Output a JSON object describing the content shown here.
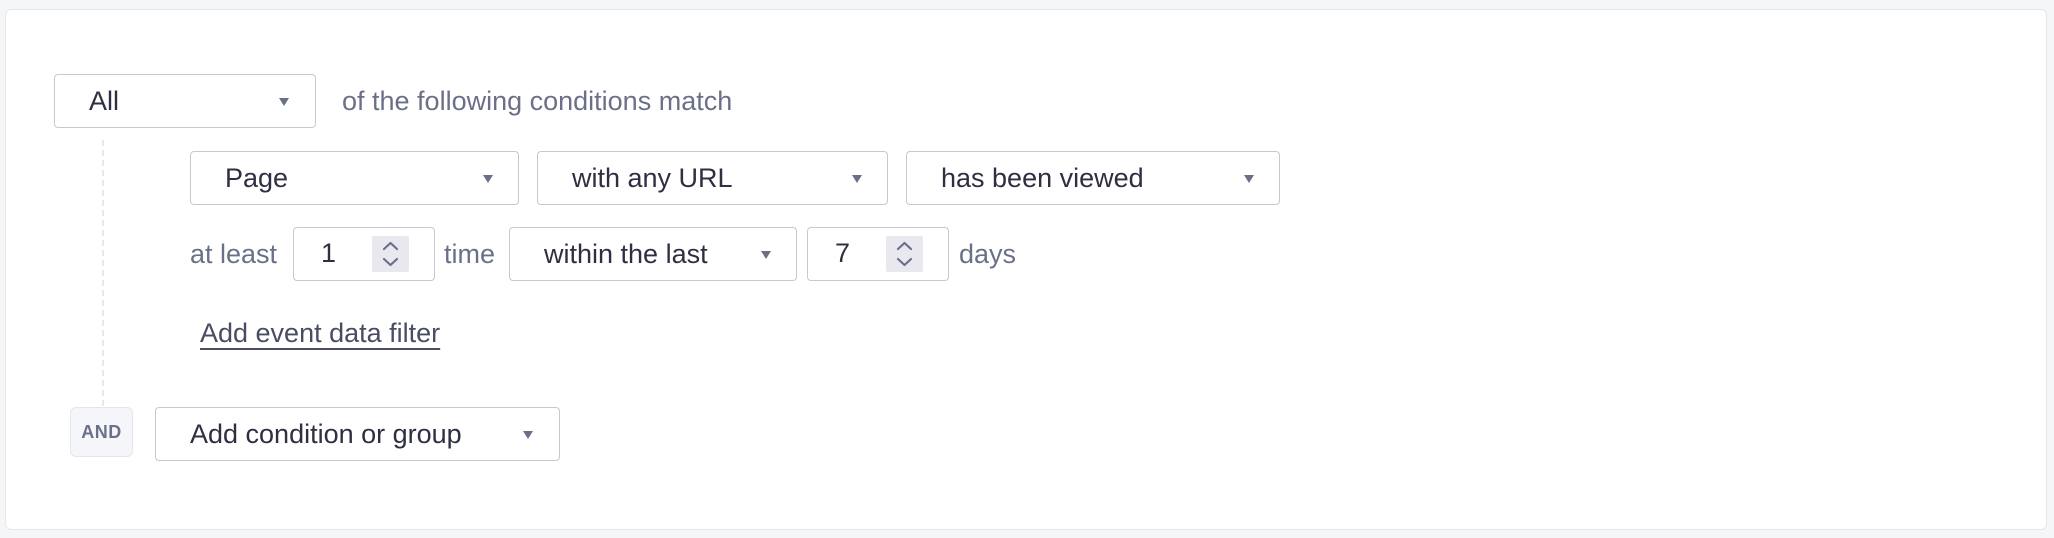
{
  "group": {
    "match_select": {
      "value": "All",
      "icon": "caret-down-icon"
    },
    "match_suffix": "of the following conditions match"
  },
  "condition": {
    "type_select": {
      "value": "Page",
      "icon": "caret-down-icon"
    },
    "url_select": {
      "value": "with any URL",
      "icon": "caret-down-icon"
    },
    "action_select": {
      "value": "has been viewed",
      "icon": "caret-down-icon"
    },
    "frequency_prefix": "at least",
    "count_input": {
      "value": "1",
      "icon": "spinner-icon"
    },
    "count_unit": "time",
    "timeframe_select": {
      "value": "within the last",
      "icon": "caret-down-icon"
    },
    "period_input": {
      "value": "7",
      "icon": "spinner-icon"
    },
    "period_unit": "days",
    "add_filter_link": "Add event data filter"
  },
  "footer": {
    "operator_badge": "AND",
    "add_condition_select": {
      "value": "Add condition or group",
      "icon": "caret-down-icon"
    }
  }
}
